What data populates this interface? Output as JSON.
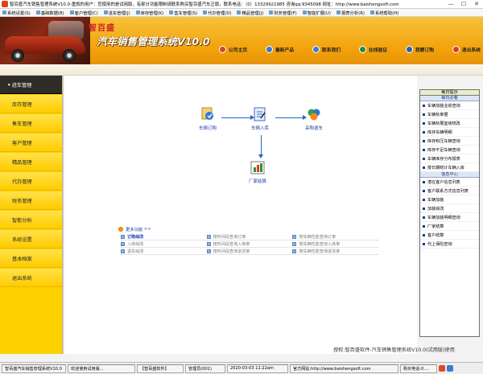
{
  "window": {
    "title": "智百盛汽车销售管理系统V10.0-重叙的用户：您使用的是试用版，有部分功能限制请联系购买智百盛汽车正版，联系电话：（0）13329921985  咨询qq:9345098  网址：http://www.baishengsoft.com",
    "minimize": "—",
    "maximize": "☐",
    "close": "✕"
  },
  "menu": [
    "系统设置(S)",
    "基础数据(B)",
    "客户管理(C)",
    "进车管理(J)",
    "库存管理(K)",
    "售车管理(S)",
    "代办管理(D)",
    "精品管理(J)",
    "财务管理(F)",
    "智能扩展(U)",
    "报表分析(R)",
    "系统帮助(H)"
  ],
  "banner": {
    "brand": "智百盛",
    "product": "汽车销售管理系统V10.0",
    "links": [
      {
        "label": "公司主页",
        "icon": "home-globe-icon",
        "color": "#d2452a"
      },
      {
        "label": "最新产品",
        "icon": "products-icon",
        "color": "#3f74c8"
      },
      {
        "label": "联系我们",
        "icon": "contact-icon",
        "color": "#3a7bd5"
      },
      {
        "label": "在线验证",
        "icon": "verify-icon",
        "color": "#1f8a4a"
      },
      {
        "label": "我要订购",
        "icon": "order-icon",
        "color": "#2b5fb0"
      },
      {
        "label": "退出系统",
        "icon": "exit-icon",
        "color": "#d23c2a"
      }
    ]
  },
  "sidebar": [
    {
      "label": "进车管理",
      "active": true
    },
    {
      "label": "库存管理",
      "active": false
    },
    {
      "label": "售车管理",
      "active": false
    },
    {
      "label": "客户管理",
      "active": false
    },
    {
      "label": "精品管理",
      "active": false
    },
    {
      "label": "代办管理",
      "active": false
    },
    {
      "label": "财务管理",
      "active": false
    },
    {
      "label": "智能分析",
      "active": false
    },
    {
      "label": "系统设置",
      "active": false
    },
    {
      "label": "基本档案",
      "active": false
    },
    {
      "label": "退出系统",
      "active": false
    }
  ],
  "flow": {
    "order": "车辆订购",
    "inbound": "车辆入库",
    "purchase_return": "采购退车",
    "settlement": "厂家结算"
  },
  "more": {
    "title": "更多功能",
    "title_suffix": ">>",
    "rows": [
      [
        "订购综改",
        "按时间段查询订单",
        "按车辆性能查询订单"
      ],
      [
        "入库综改",
        "按时间段查询入库单",
        "按车辆性能查询入库单"
      ],
      [
        "退车综改",
        "按时间段查询退货单",
        "按车辆性能查询退货单"
      ]
    ]
  },
  "tips": {
    "header": "每日提示",
    "section1": "每日必看",
    "items1": [
      "车辆加装业绩查询",
      "车辆标单据",
      "车辆标展室级统改",
      "库存车辆明细",
      "库存积压车辆查询",
      "库存不足车辆查询",
      "车辆库存分布报表",
      "按日期统计车辆入库"
    ],
    "section2": "信息中心",
    "items2": [
      "潜在客户信息列表",
      "客户联系方式信息列表",
      "车辆加装",
      "加装综改",
      "车辆加装明细查询",
      "厂家结算",
      "客户结算",
      "代上保险查询"
    ]
  },
  "copyright": "授权:智百盛软件-汽车销售管理系统V10.0(试用版)使用",
  "status": {
    "app": "智百盛汽车销售管理系统V10.0",
    "welcome": "欢迎使用试用版...",
    "company": "【智百盛软件】",
    "user": "管理员(001)",
    "datetime": "2020-03-03 11:22am",
    "site": "官方网站:http://www.baishengsoft.com",
    "phone": "购买电话:0...."
  }
}
